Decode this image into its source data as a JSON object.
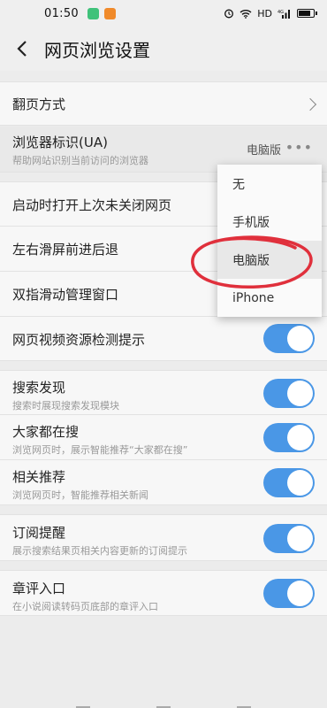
{
  "status": {
    "time": "01:50",
    "network": "HD",
    "signal": "4G"
  },
  "header": {
    "title": "网页浏览设置"
  },
  "settings": {
    "page_turn": {
      "label": "翻页方式"
    },
    "ua": {
      "label": "浏览器标识(UA)",
      "sub": "帮助网站识别当前访问的浏览器",
      "value": "电脑版",
      "more": "•••"
    },
    "restore_tabs": {
      "label": "启动时打开上次未关闭网页"
    },
    "swipe_nav": {
      "label": "左右滑屏前进后退"
    },
    "two_finger": {
      "label": "双指滑动管理窗口"
    },
    "video_detect": {
      "label": "网页视频资源检测提示",
      "enabled": true
    },
    "search_discover": {
      "label": "搜索发现",
      "sub": "搜索时展现搜索发现模块",
      "enabled": true
    },
    "everyone_search": {
      "label": "大家都在搜",
      "sub": "浏览网页时，展示智能推荐“大家都在搜”",
      "enabled": true
    },
    "related": {
      "label": "相关推荐",
      "sub": "浏览网页时，智能推荐相关新闻",
      "enabled": true
    },
    "subscribe": {
      "label": "订阅提醒",
      "sub": "展示搜索结果页相关内容更新的订阅提示",
      "enabled": true
    },
    "chapter_comment": {
      "label": "章评入口",
      "sub": "在小说阅读转码页底部的章评入口",
      "enabled": true
    }
  },
  "ua_menu": {
    "options": [
      "无",
      "手机版",
      "电脑版",
      "iPhone"
    ],
    "selected": "电脑版"
  },
  "colors": {
    "toggle_on": "#4a97e6",
    "annotation": "#e0303c"
  }
}
